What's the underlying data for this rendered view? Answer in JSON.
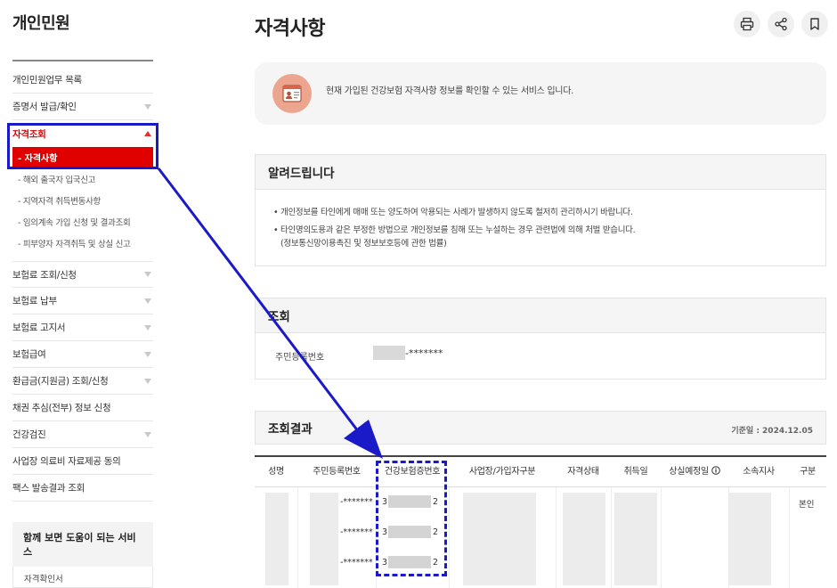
{
  "sidebar": {
    "title": "개인민원",
    "items": [
      {
        "label": "개인민원업무 목록"
      },
      {
        "label": "증명서 발급/확인"
      },
      {
        "label": "자격조회"
      },
      {
        "label": "보험료 조회/신청"
      },
      {
        "label": "보험료 납부"
      },
      {
        "label": "보험료 고지서"
      },
      {
        "label": "보험급여"
      },
      {
        "label": "환급금(지원금) 조회/신청"
      },
      {
        "label": "채권 추심(전부) 정보 신청"
      },
      {
        "label": "건강검진"
      },
      {
        "label": "사업장 의료비 자료제공 동의"
      },
      {
        "label": "팩스 발송결과 조회"
      }
    ],
    "sub_selected": "- 자격사항",
    "sub_items": [
      {
        "label": "- 해외 출국자 입국신고"
      },
      {
        "label": "- 지역자격 취득변동사항"
      },
      {
        "label": "- 임의계속 가입 신청 및 결과조회"
      },
      {
        "label": "- 피부양자 자격취득 및 상실 신고"
      }
    ],
    "related": {
      "title": "함께 보면 도움이 되는 서비스",
      "item": "자격확인서"
    }
  },
  "main": {
    "title": "자격사항",
    "icons": [
      "print-icon",
      "share-icon",
      "bookmark-icon"
    ],
    "intro_text": "현재 가입된 건강보험 자격사항 정보를 확인할 수 있는 서비스 입니다.",
    "notice": {
      "heading": "알려드립니다",
      "line1": "• 개인정보를 타인에게 매매 또는 양도하여 악용되는 사례가 발생하지 않도록 철저히 관리하시기 바랍니다.",
      "line2": "• 타인명의도용과 같은 부정한 방법으로 개인정보를 침해 또는 누설하는 경우 관련법에 의해 처벌 받습니다.",
      "line3": "(정보통신망이용촉진 및 정보보호등에 관한 법률)"
    },
    "query": {
      "heading": "조회",
      "label": "주민등록번호",
      "value_suffix": "-*******"
    },
    "result": {
      "heading": "조회결과",
      "base_date": "기준일 : 2024.12.05",
      "columns": [
        "성명",
        "주민등록번호",
        "건강보험증번호",
        "사업장/가입자구분",
        "자격상태",
        "취득일",
        "상실예정일",
        "소속지사",
        "구분"
      ],
      "info_icon": "info-circle-icon",
      "rows": [
        {
          "rrn": "-*******",
          "card_prefix": "3",
          "card_suffix": "2",
          "type": "본인"
        },
        {
          "rrn": "-*******",
          "card_prefix": "3",
          "card_suffix": "2",
          "type": ""
        },
        {
          "rrn": "-*******",
          "card_prefix": "3",
          "card_suffix": "2",
          "type": ""
        }
      ]
    }
  },
  "colors": {
    "accent_red": "#e10000",
    "annotation_blue": "#1a1ac8",
    "panel_bg": "#f5f5f5"
  }
}
